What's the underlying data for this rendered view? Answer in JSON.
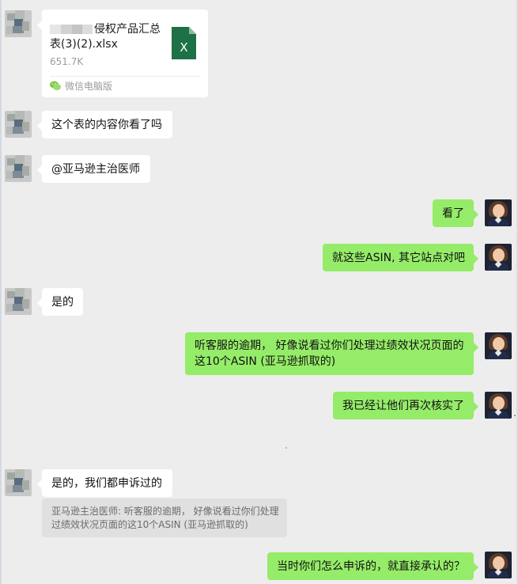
{
  "file": {
    "name_line1": "侵权产品汇总",
    "name_line2": "表(3)(2).xlsx",
    "size": "651.7K",
    "source": "微信电脑版",
    "icon": "excel-file-icon",
    "icon_letter": "X"
  },
  "messages": [
    {
      "sender": "other",
      "text": "这个表的内容你看了吗"
    },
    {
      "sender": "other",
      "text": "@亚马逊主治医师"
    },
    {
      "sender": "me",
      "text": "看了"
    },
    {
      "sender": "me",
      "text": "就这些ASIN, 其它站点对吧"
    },
    {
      "sender": "other",
      "text": "是的"
    },
    {
      "sender": "me",
      "lines": [
        "听客服的逾期， 好像说看过你们处理过绩效状况页面的",
        "这10个ASIN (亚马逊抓取的)"
      ]
    },
    {
      "sender": "me",
      "text": "我已经让他们再次核实了"
    },
    {
      "sender": "other",
      "text": "是的，我们都申诉过的"
    },
    {
      "sender": "me",
      "text": "当时你们怎么申诉的，就直接承认的？"
    }
  ],
  "quote": {
    "lines": [
      "亚马逊主治医师: 听客服的逾期， 好像说看过你们处理",
      "过绩效状况页面的这10个ASIN (亚马逊抓取的)"
    ]
  },
  "colors": {
    "background": "#ededed",
    "incoming_bubble": "#ffffff",
    "outgoing_bubble": "#95ec69",
    "quote_background": "#e0e0e0",
    "excel_green": "#1e7145"
  }
}
